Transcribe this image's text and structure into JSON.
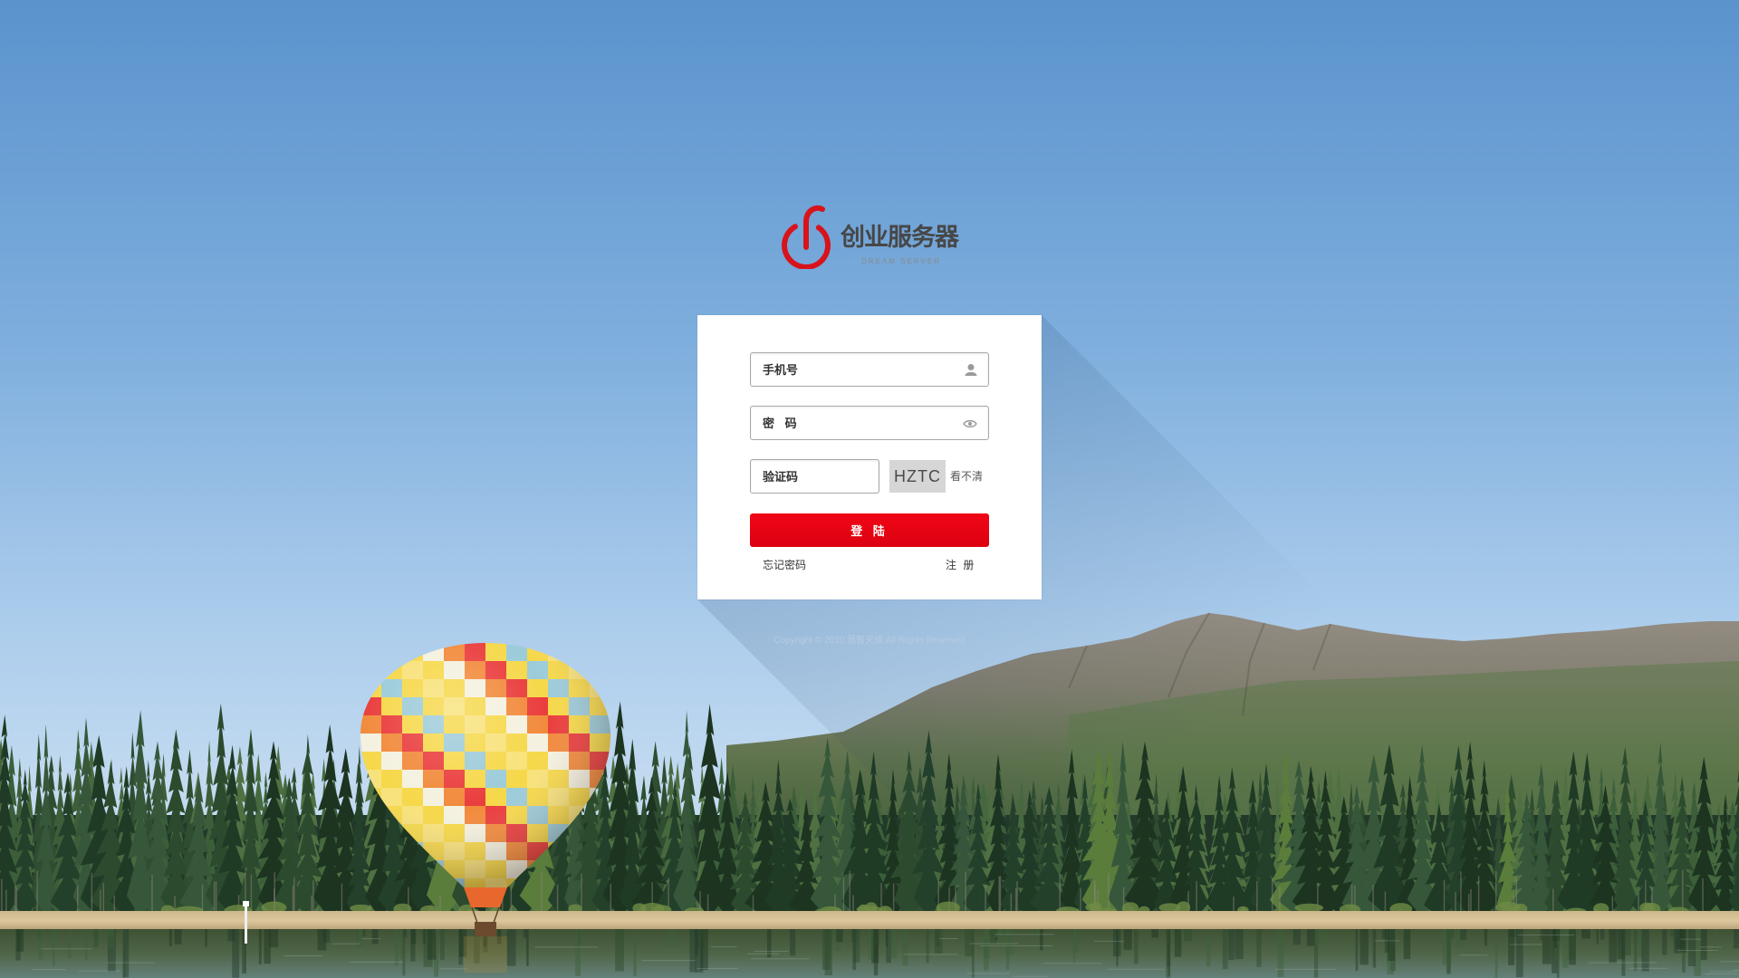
{
  "brand": {
    "name": "创业服务器",
    "tagline": "DREAM SERVER",
    "logo_icon": "power-s-logo-icon"
  },
  "login_form": {
    "phone": {
      "placeholder": "手机号",
      "icon": "user-icon"
    },
    "password": {
      "placeholder": "密 码",
      "icon": "eye-icon"
    },
    "captcha": {
      "placeholder": "验证码",
      "image_text": "HZTC",
      "refresh_label": "看不清"
    },
    "submit_label": "登 陆",
    "forgot_password_label": "忘记密码",
    "register_label": "注 册"
  },
  "footer": {
    "copyright": "Copyright © 2010 慧智天成 All Rights Reserved"
  },
  "colors": {
    "accent": "#e60012",
    "brand_red": "#d7141b",
    "brand_text": "#474747",
    "input_border": "#a8a8a8"
  }
}
